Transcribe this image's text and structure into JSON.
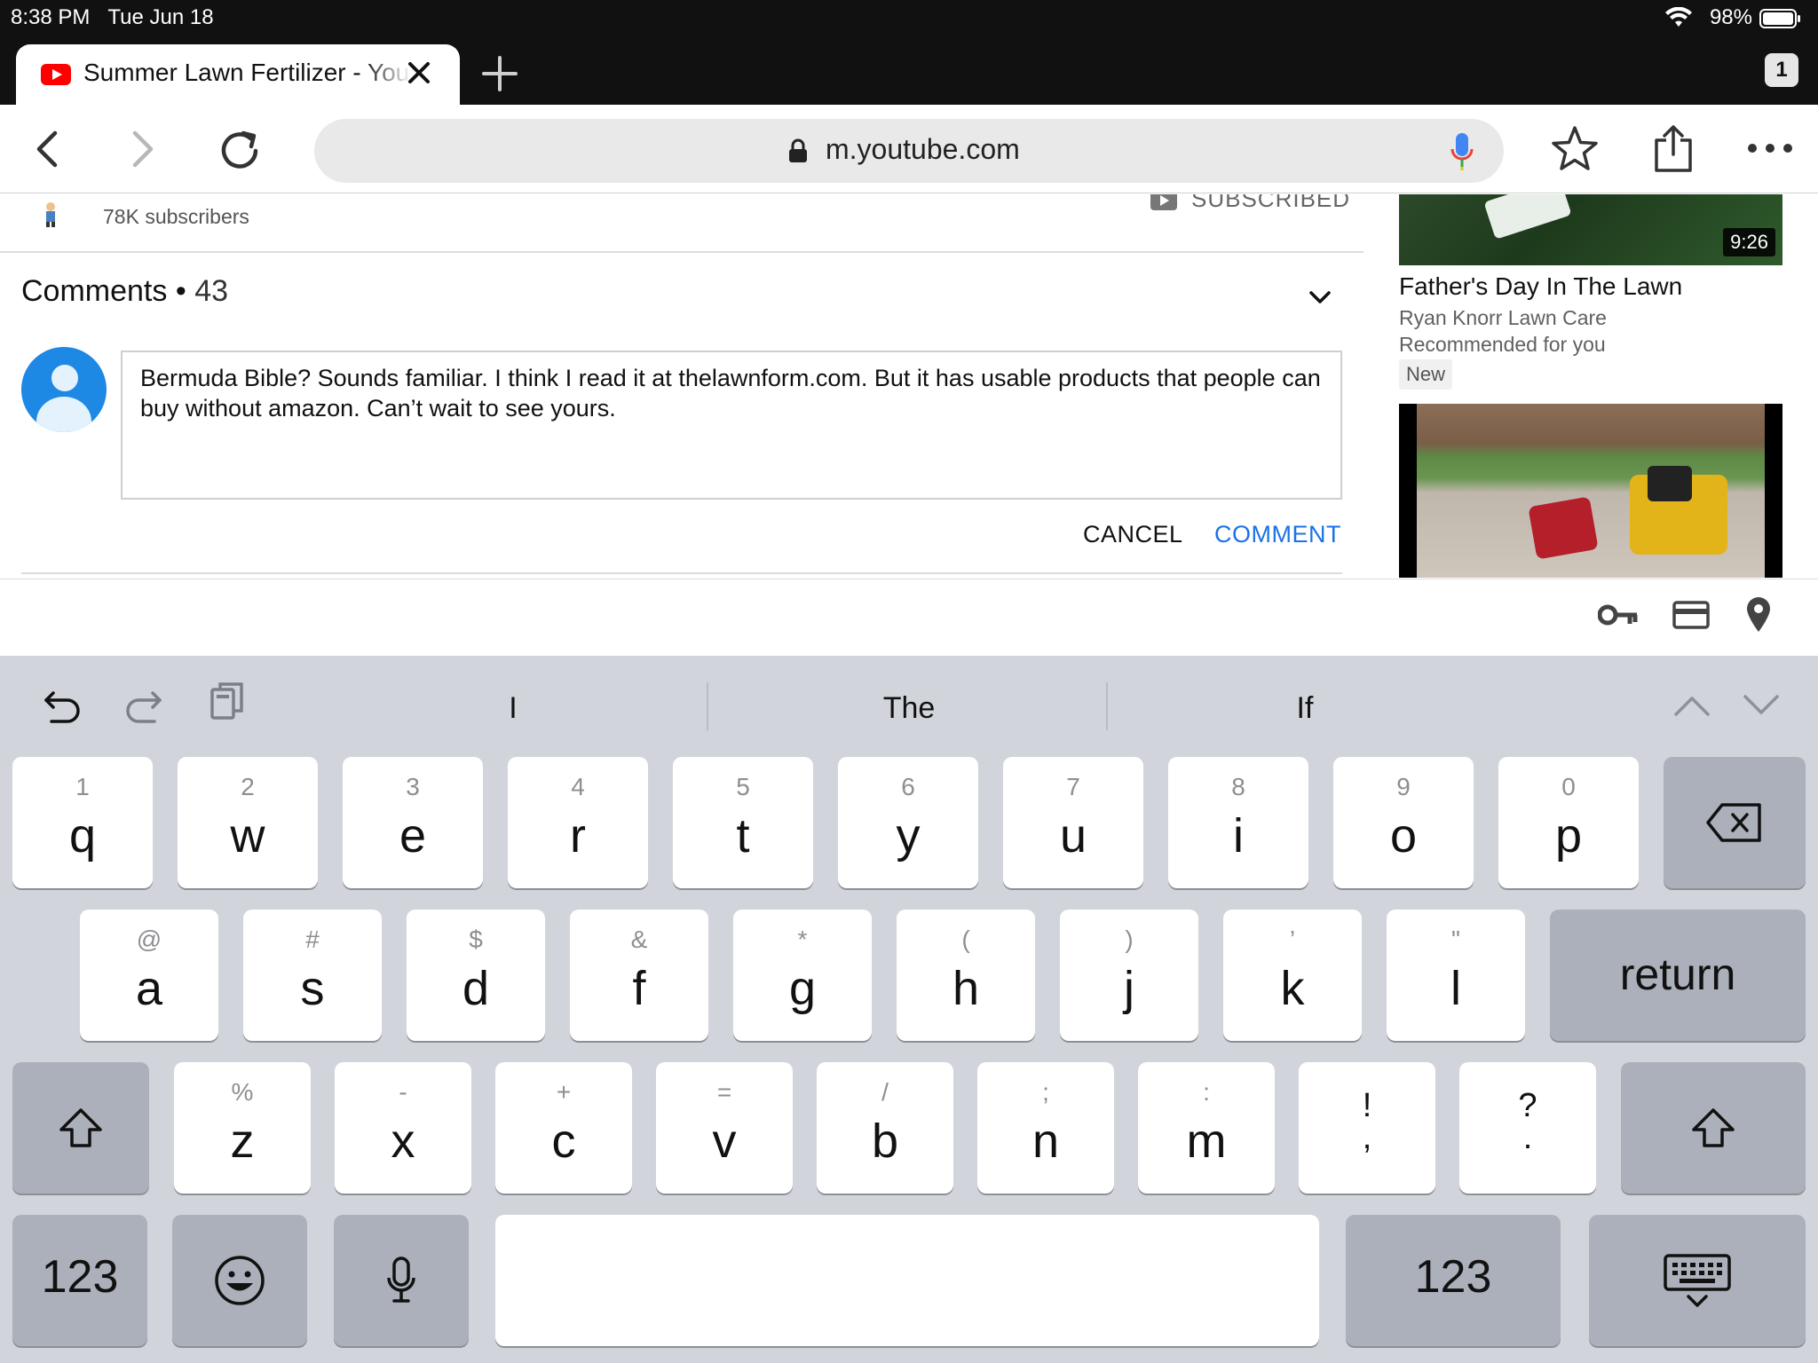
{
  "status": {
    "time": "8:38 PM",
    "date": "Tue Jun 18",
    "battery": "98%"
  },
  "tab": {
    "title": "Summer Lawn Fertilizer - YouTube",
    "count": "1"
  },
  "toolbar": {
    "url": "m.youtube.com"
  },
  "channel": {
    "subscribers": "78K subscribers",
    "subscribed_label": "SUBSCRIBED"
  },
  "comments": {
    "label": "Comments",
    "separator": "•",
    "count": "43",
    "draft": "Bermuda Bible? Sounds familiar. I think I read it at thelawnform.com. But it has usable products that people can buy without amazon. Can’t wait to see yours.",
    "cancel_label": "CANCEL",
    "comment_label": "COMMENT"
  },
  "recommended": [
    {
      "duration": "9:26",
      "title": "Father's Day In The Lawn",
      "channel": "Ryan Knorr Lawn Care",
      "reason": "Recommended for you",
      "badge": "New"
    }
  ],
  "keyboard": {
    "suggestions": [
      "I",
      "The",
      "If"
    ],
    "row1": [
      {
        "sub": "1",
        "main": "q"
      },
      {
        "sub": "2",
        "main": "w"
      },
      {
        "sub": "3",
        "main": "e"
      },
      {
        "sub": "4",
        "main": "r"
      },
      {
        "sub": "5",
        "main": "t"
      },
      {
        "sub": "6",
        "main": "y"
      },
      {
        "sub": "7",
        "main": "u"
      },
      {
        "sub": "8",
        "main": "i"
      },
      {
        "sub": "9",
        "main": "o"
      },
      {
        "sub": "0",
        "main": "p"
      }
    ],
    "row2": [
      {
        "sub": "@",
        "main": "a"
      },
      {
        "sub": "#",
        "main": "s"
      },
      {
        "sub": "$",
        "main": "d"
      },
      {
        "sub": "&",
        "main": "f"
      },
      {
        "sub": "*",
        "main": "g"
      },
      {
        "sub": "(",
        "main": "h"
      },
      {
        "sub": ")",
        "main": "j"
      },
      {
        "sub": "’",
        "main": "k"
      },
      {
        "sub": "\"",
        "main": "l"
      }
    ],
    "row3": [
      {
        "sub": "%",
        "main": "z"
      },
      {
        "sub": "-",
        "main": "x"
      },
      {
        "sub": "+",
        "main": "c"
      },
      {
        "sub": "=",
        "main": "v"
      },
      {
        "sub": "/",
        "main": "b"
      },
      {
        "sub": ";",
        "main": "n"
      },
      {
        "sub": ":",
        "main": "m"
      }
    ],
    "punct": [
      {
        "top": "!",
        "bottom": ","
      },
      {
        "top": "?",
        "bottom": "."
      }
    ],
    "return_label": "return",
    "numbers_label": "123"
  }
}
